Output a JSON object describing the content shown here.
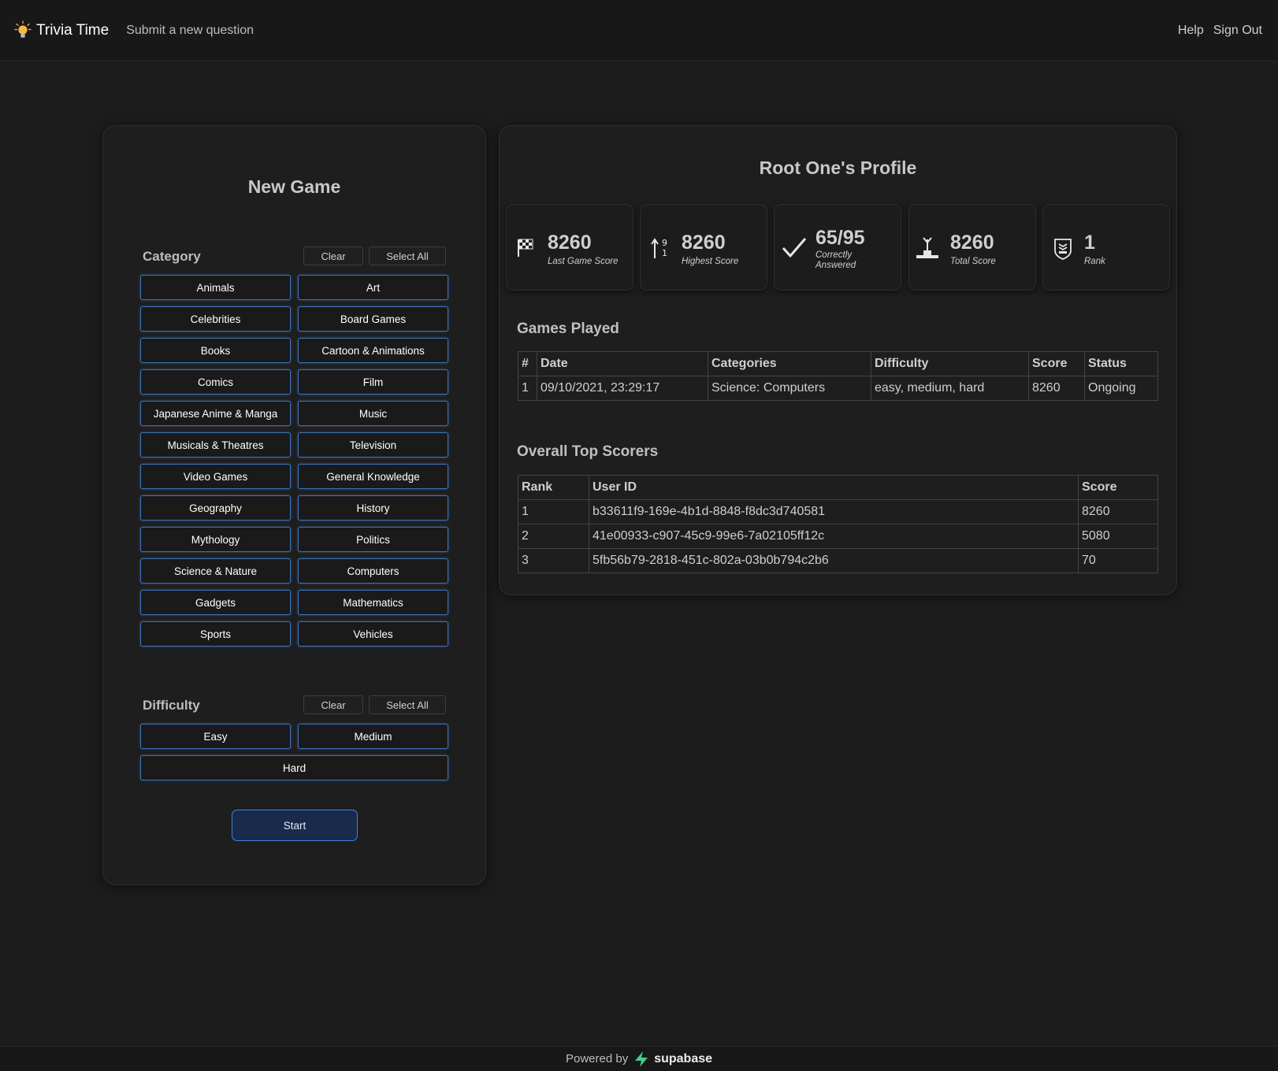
{
  "nav": {
    "brand_icon": "lightbulb-icon",
    "brand": "Trivia Time",
    "submit_link": "Submit a new question",
    "help": "Help",
    "sign_out": "Sign Out"
  },
  "new_game": {
    "title": "New Game",
    "category": {
      "label": "Category",
      "clear": "Clear",
      "select_all": "Select All",
      "options": [
        "Animals",
        "Art",
        "Celebrities",
        "Board Games",
        "Books",
        "Cartoon & Animations",
        "Comics",
        "Film",
        "Japanese Anime & Manga",
        "Music",
        "Musicals & Theatres",
        "Television",
        "Video Games",
        "General Knowledge",
        "Geography",
        "History",
        "Mythology",
        "Politics",
        "Science & Nature",
        "Computers",
        "Gadgets",
        "Mathematics",
        "Sports",
        "Vehicles"
      ]
    },
    "difficulty": {
      "label": "Difficulty",
      "clear": "Clear",
      "select_all": "Select All",
      "options": [
        "Easy",
        "Medium",
        "Hard"
      ]
    },
    "start": "Start"
  },
  "profile": {
    "title": "Root One's Profile",
    "stats": [
      {
        "icon": "checkered-flag-icon",
        "value": "8260",
        "label": "Last Game Score"
      },
      {
        "icon": "sort-numeric-up-icon",
        "value": "8260",
        "label": "Highest Score"
      },
      {
        "icon": "checkmark-icon",
        "value": "65/95",
        "label": "Correctly Answered"
      },
      {
        "icon": "podium-icon",
        "value": "8260",
        "label": "Total Score"
      },
      {
        "icon": "rank-badge-icon",
        "value": "1",
        "label": "Rank"
      }
    ],
    "games_played": {
      "title": "Games Played",
      "headers": [
        "#",
        "Date",
        "Categories",
        "Difficulty",
        "Score",
        "Status"
      ],
      "rows": [
        [
          "1",
          "09/10/2021, 23:29:17",
          "Science: Computers",
          "easy, medium, hard",
          "8260",
          "Ongoing"
        ]
      ]
    },
    "top_scorers": {
      "title": "Overall Top Scorers",
      "headers": [
        "Rank",
        "User ID",
        "Score"
      ],
      "rows": [
        [
          "1",
          "b33611f9-169e-4b1d-8848-f8dc3d740581",
          "8260"
        ],
        [
          "2",
          "41e00933-c907-45c9-99e6-7a02105ff12c",
          "5080"
        ],
        [
          "3",
          "5fb56b79-2818-451c-802a-03b0b794c2b6",
          "70"
        ]
      ]
    }
  },
  "footer": {
    "powered_by": "Powered by",
    "logo_icon": "supabase-bolt-icon",
    "brand": "supabase",
    "brand_color": "#3ecf8e"
  }
}
